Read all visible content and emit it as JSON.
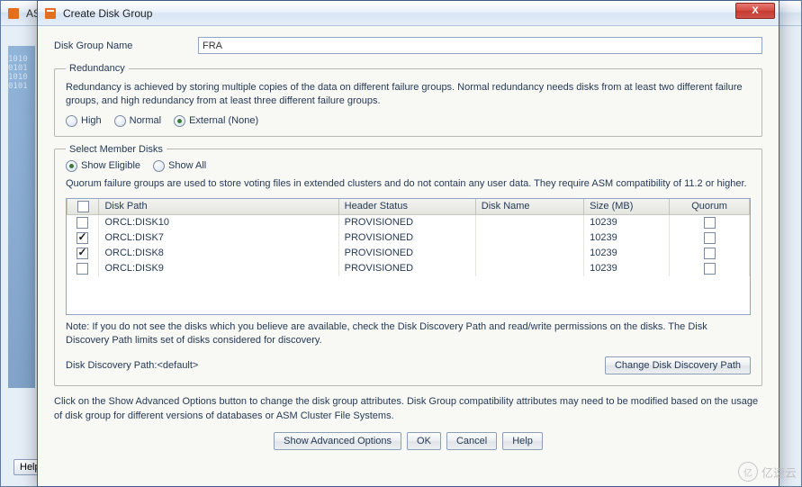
{
  "bg": {
    "title_prefix": "AS",
    "help": "Help"
  },
  "window": {
    "title": "Create Disk Group",
    "close": "X"
  },
  "form": {
    "name_label": "Disk Group Name",
    "name_value": "FRA"
  },
  "redundancy": {
    "legend": "Redundancy",
    "desc": "Redundancy is achieved by storing multiple copies of the data on different failure groups. Normal redundancy needs disks from at least two different failure groups, and high redundancy from at least three different failure groups.",
    "options": {
      "high": "High",
      "normal": "Normal",
      "external": "External (None)"
    },
    "selected": "external"
  },
  "member": {
    "legend": "Select Member Disks",
    "show_eligible": "Show Eligible",
    "show_all": "Show All",
    "show_selected": "eligible",
    "quorum_desc": "Quorum failure groups are used to store voting files in extended clusters and do not contain any user data. They require ASM compatibility of 11.2 or higher.",
    "columns": {
      "path": "Disk Path",
      "header_status": "Header Status",
      "disk_name": "Disk Name",
      "size": "Size (MB)",
      "quorum": "Quorum"
    },
    "rows": [
      {
        "checked": false,
        "path": "ORCL:DISK10",
        "status": "PROVISIONED",
        "name": "",
        "size": "10239",
        "quorum": false
      },
      {
        "checked": true,
        "path": "ORCL:DISK7",
        "status": "PROVISIONED",
        "name": "",
        "size": "10239",
        "quorum": false
      },
      {
        "checked": true,
        "path": "ORCL:DISK8",
        "status": "PROVISIONED",
        "name": "",
        "size": "10239",
        "quorum": false
      },
      {
        "checked": false,
        "path": "ORCL:DISK9",
        "status": "PROVISIONED",
        "name": "",
        "size": "10239",
        "quorum": false
      }
    ],
    "note": "Note: If you do not see the disks which you believe are available, check the Disk Discovery Path and read/write permissions on the disks. The Disk Discovery Path limits set of disks considered for discovery.",
    "discovery_label": "Disk Discovery Path:",
    "discovery_value": "<default>",
    "change_btn": "Change Disk Discovery Path"
  },
  "footer": {
    "desc": "Click on the Show Advanced Options button to change the disk group attributes. Disk Group compatibility attributes may need to be modified based on the usage of disk group for different versions of databases or ASM Cluster File Systems.",
    "advanced": "Show Advanced Options",
    "ok": "OK",
    "cancel": "Cancel",
    "help": "Help"
  },
  "watermark": "亿速云"
}
